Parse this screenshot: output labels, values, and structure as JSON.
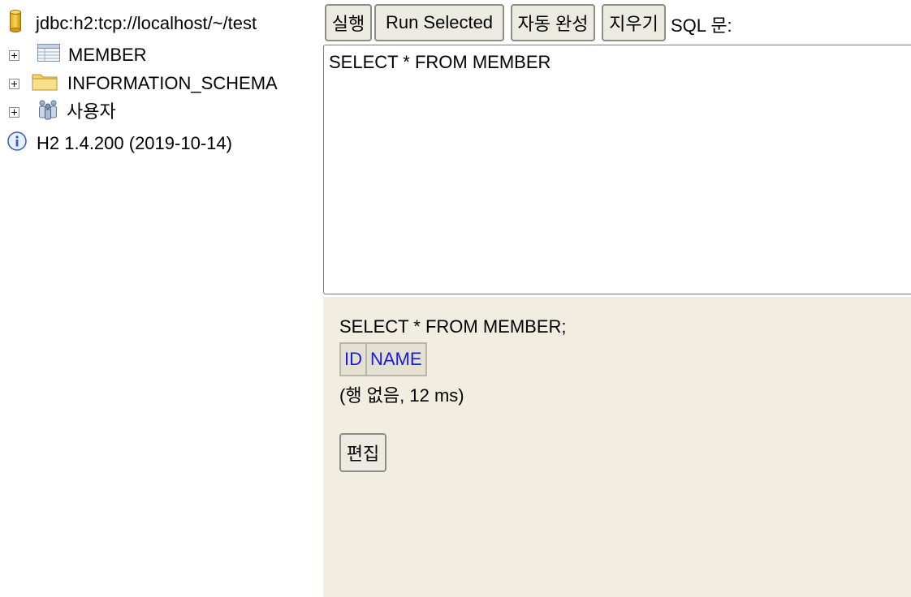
{
  "tree": {
    "connection": {
      "label": "jdbc:h2:tcp://localhost/~/test",
      "icon": "database-icon"
    },
    "items": [
      {
        "label": "MEMBER",
        "icon": "table-icon"
      },
      {
        "label": "INFORMATION_SCHEMA",
        "icon": "folder-icon"
      },
      {
        "label": "사용자",
        "icon": "users-icon"
      }
    ],
    "version": {
      "label": "H2 1.4.200 (2019-10-14)",
      "icon": "info-icon"
    }
  },
  "toolbar": {
    "run_label": "실행",
    "run_selected_label": "Run Selected",
    "autocomplete_label": "자동 완성",
    "clear_label": "지우기",
    "sql_caption": "SQL 문:"
  },
  "editor": {
    "value": "SELECT * FROM MEMBER"
  },
  "results": {
    "query": "SELECT * FROM MEMBER;",
    "columns": [
      "ID",
      "NAME"
    ],
    "status": "(행 없음, 12 ms)",
    "edit_label": "편집"
  },
  "colors": {
    "result_background": "#f1eee1",
    "column_header_text": "#1a1adc",
    "button_background": "#ecebe2"
  }
}
